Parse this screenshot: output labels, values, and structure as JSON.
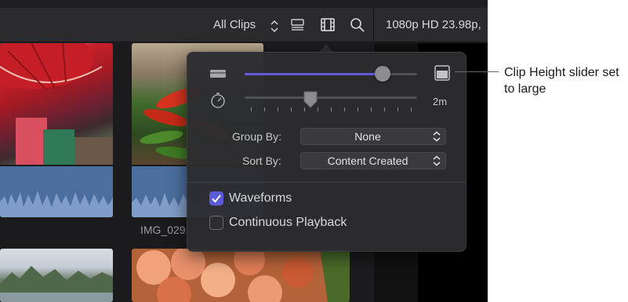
{
  "toolbar": {
    "clips_filter": "All Clips",
    "format": "1080p HD 23.98p,",
    "icons": [
      "list-view-icon",
      "clip-appearance-icon",
      "search-icon"
    ]
  },
  "browser": {
    "clip_name": "IMG_029"
  },
  "popover": {
    "clip_height": 0.8,
    "duration_value": 0.38,
    "duration_label": "2m",
    "group_by": {
      "label": "Group By:",
      "value": "None"
    },
    "sort_by": {
      "label": "Sort By:",
      "value": "Content Created"
    },
    "waveforms": {
      "label": "Waveforms",
      "checked": true
    },
    "continuous_playback": {
      "label": "Continuous Playback",
      "checked": false
    }
  },
  "callout": {
    "text": "Clip Height slider set to large"
  },
  "colors": {
    "accent": "#5d5bd6",
    "waveform": "#4c6e9e",
    "panel": "#2c2c30"
  }
}
